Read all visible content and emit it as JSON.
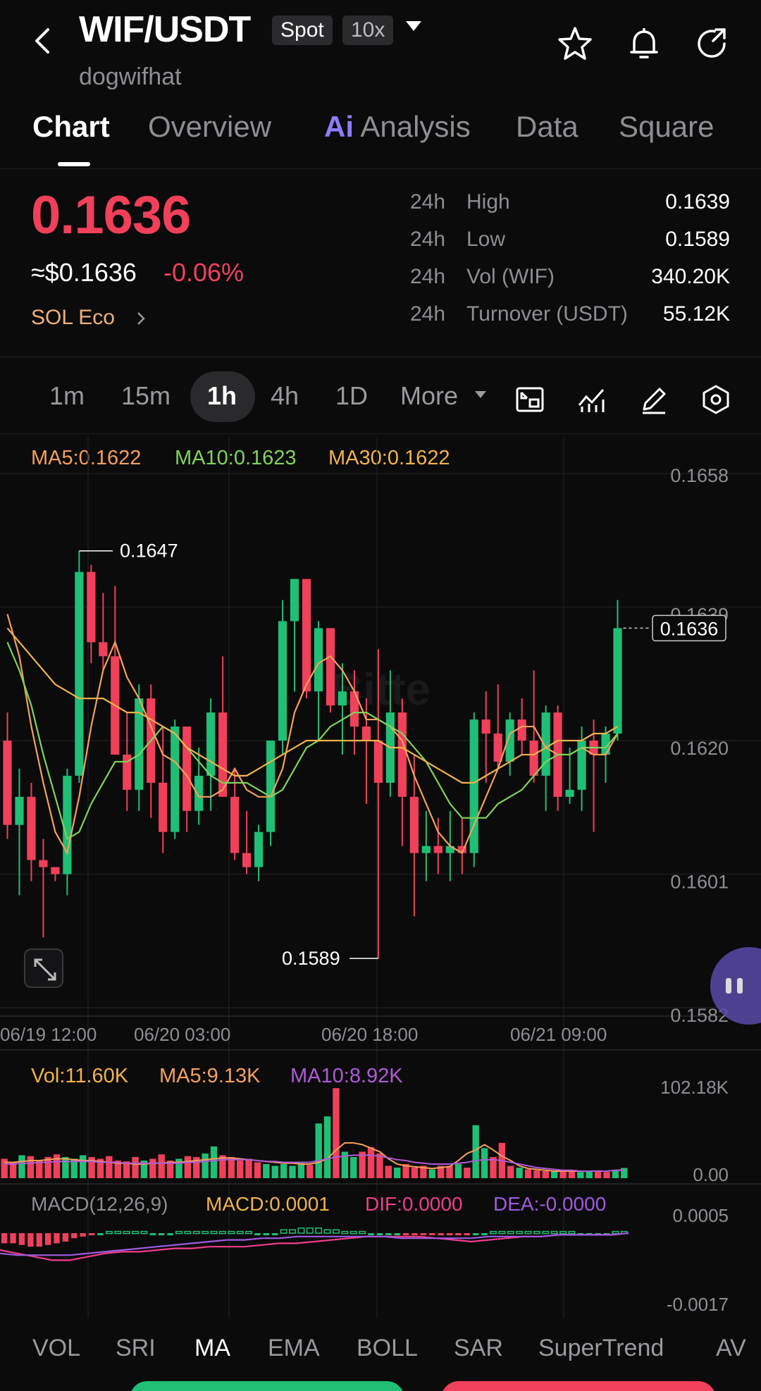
{
  "header": {
    "pair": "WIF/USDT",
    "spot_tag": "Spot",
    "leverage_tag": "10x",
    "subname": "dogwifhat"
  },
  "tabs": [
    {
      "label": "Chart"
    },
    {
      "label": "Overview"
    },
    {
      "label": "Analysis",
      "badge": "Ai"
    },
    {
      "label": "Data"
    },
    {
      "label": "Square"
    }
  ],
  "price": {
    "last": "0.1636",
    "usd": "≈$0.1636",
    "change": "-0.06%",
    "eco": "SOL Eco"
  },
  "stats": [
    {
      "period": "24h",
      "label": "High",
      "value": "0.1639"
    },
    {
      "period": "24h",
      "label": "Low",
      "value": "0.1589"
    },
    {
      "period": "24h",
      "label": "Vol (WIF)",
      "value": "340.20K"
    },
    {
      "period": "24h",
      "label": "Turnover (USDT)",
      "value": "55.12K"
    }
  ],
  "intervals": [
    "1m",
    "15m",
    "1h",
    "4h",
    "1D",
    "More"
  ],
  "chart": {
    "ma_legend": {
      "ma5": "MA5:0.1622",
      "ma10": "MA10:0.1623",
      "ma30": "MA30:0.1622"
    },
    "price_axis": [
      "0.1658",
      "0.1639",
      "0.1620",
      "0.1601",
      "0.1582"
    ],
    "current_price_tag": "0.1636",
    "high_label": "0.1647",
    "low_label": "0.1589",
    "time_axis": [
      "06/19 12:00",
      "06/20 03:00",
      "06/20 18:00",
      "06/21 09:00"
    ],
    "volume_legend": {
      "vol": "Vol:11.60K",
      "ma5": "MA5:9.13K",
      "ma10": "MA10:8.92K"
    },
    "volume_axis": [
      "102.18K",
      "0.00"
    ],
    "macd_legend": {
      "name": "MACD(12,26,9)",
      "macd": "MACD:0.0001",
      "dif": "DIF:0.0000",
      "dea": "DEA:-0.0000"
    },
    "macd_axis": [
      "0.0005",
      "-0.0017"
    ],
    "colors": {
      "up": "#1fbf75",
      "down": "#f0405a",
      "ma5": "#f5a05a",
      "ma10": "#7fd45a",
      "ma30": "#f2b24a",
      "vol_ma10": "#b05ad8",
      "dif": "#f03c8c",
      "dea": "#a05ae0"
    }
  },
  "indicator_tabs": [
    "VOL",
    "SRI",
    "MA",
    "EMA",
    "BOLL",
    "SAR",
    "SuperTrend",
    "AV"
  ],
  "chart_data": {
    "type": "candlestick",
    "interval": "1h",
    "ylim": [
      0.1582,
      0.1658
    ],
    "x_ticks": [
      "06/19 12:00",
      "06/20 03:00",
      "06/20 18:00",
      "06/21 09:00"
    ],
    "candles": [
      [
        0.162,
        0.1624,
        0.1606,
        0.1608
      ],
      [
        0.1608,
        0.1616,
        0.1598,
        0.1612
      ],
      [
        0.1612,
        0.1614,
        0.16,
        0.1603
      ],
      [
        0.1603,
        0.1606,
        0.1592,
        0.1602
      ],
      [
        0.1602,
        0.1602,
        0.16,
        0.1601
      ],
      [
        0.1601,
        0.1616,
        0.1598,
        0.1615
      ],
      [
        0.1615,
        0.1647,
        0.1614,
        0.1644
      ],
      [
        0.1644,
        0.1645,
        0.1631,
        0.1634
      ],
      [
        0.1634,
        0.1641,
        0.163,
        0.1632
      ],
      [
        0.1632,
        0.1642,
        0.1618,
        0.1618
      ],
      [
        0.1618,
        0.1624,
        0.161,
        0.1613
      ],
      [
        0.1613,
        0.1628,
        0.161,
        0.1626
      ],
      [
        0.1626,
        0.1628,
        0.1609,
        0.1614
      ],
      [
        0.1614,
        0.1622,
        0.1604,
        0.1607
      ],
      [
        0.1607,
        0.1623,
        0.1606,
        0.1622
      ],
      [
        0.1622,
        0.1622,
        0.1607,
        0.161
      ],
      [
        0.161,
        0.1619,
        0.1608,
        0.1615
      ],
      [
        0.1615,
        0.1626,
        0.161,
        0.1624
      ],
      [
        0.1624,
        0.1632,
        0.1612,
        0.1612
      ],
      [
        0.1612,
        0.1616,
        0.1603,
        0.1604
      ],
      [
        0.1604,
        0.161,
        0.1601,
        0.1602
      ],
      [
        0.1602,
        0.1608,
        0.16,
        0.1607
      ],
      [
        0.1607,
        0.162,
        0.1605,
        0.162
      ],
      [
        0.162,
        0.164,
        0.1618,
        0.1637
      ],
      [
        0.1637,
        0.1642,
        0.1627,
        0.1643
      ],
      [
        0.1643,
        0.1643,
        0.1626,
        0.1627
      ],
      [
        0.1627,
        0.1637,
        0.162,
        0.1636
      ],
      [
        0.1636,
        0.1636,
        0.1624,
        0.1625
      ],
      [
        0.1625,
        0.1631,
        0.1618,
        0.1627
      ],
      [
        0.1627,
        0.163,
        0.1618,
        0.1622
      ],
      [
        0.1622,
        0.1626,
        0.1611,
        0.162
      ],
      [
        0.162,
        0.1633,
        0.1589,
        0.1614
      ],
      [
        0.1614,
        0.163,
        0.1612,
        0.1624
      ],
      [
        0.1624,
        0.1626,
        0.1605,
        0.1612
      ],
      [
        0.1612,
        0.1618,
        0.1595,
        0.1604
      ],
      [
        0.1604,
        0.161,
        0.16,
        0.1605
      ],
      [
        0.1605,
        0.1609,
        0.1601,
        0.1604
      ],
      [
        0.1604,
        0.161,
        0.16,
        0.1605
      ],
      [
        0.1605,
        0.1609,
        0.1601,
        0.1604
      ],
      [
        0.1604,
        0.1624,
        0.1602,
        0.1623
      ],
      [
        0.1623,
        0.1627,
        0.1614,
        0.1621
      ],
      [
        0.1621,
        0.1628,
        0.1616,
        0.1617
      ],
      [
        0.1617,
        0.1624,
        0.1615,
        0.1623
      ],
      [
        0.1623,
        0.1626,
        0.1618,
        0.162
      ],
      [
        0.162,
        0.163,
        0.1614,
        0.1615
      ],
      [
        0.1615,
        0.1625,
        0.161,
        0.1624
      ],
      [
        0.1624,
        0.1625,
        0.161,
        0.1612
      ],
      [
        0.1612,
        0.1619,
        0.1611,
        0.1613
      ],
      [
        0.1613,
        0.1622,
        0.161,
        0.162
      ],
      [
        0.162,
        0.1623,
        0.1607,
        0.1618
      ],
      [
        0.1618,
        0.1622,
        0.1614,
        0.1621
      ],
      [
        0.1621,
        0.164,
        0.162,
        0.1636
      ]
    ],
    "series": [
      {
        "name": "MA5",
        "values": [
          0.1638,
          0.1632,
          0.1622,
          0.1614,
          0.1607,
          0.1604,
          0.1612,
          0.1622,
          0.163,
          0.1634,
          0.1629,
          0.1626,
          0.1622,
          0.1618,
          0.1617,
          0.1615,
          0.1612,
          0.1612,
          0.1613,
          0.1616,
          0.1613,
          0.1612,
          0.1612,
          0.1616,
          0.1624,
          0.1628,
          0.1631,
          0.1632,
          0.163,
          0.1627,
          0.1623,
          0.1623,
          0.1622,
          0.162,
          0.1615,
          0.1611,
          0.1607,
          0.1605,
          0.1604,
          0.1608,
          0.1612,
          0.1616,
          0.1621,
          0.1622,
          0.1622,
          0.1619,
          0.1618,
          0.1618,
          0.1619,
          0.1618,
          0.1618,
          0.1621
        ]
      },
      {
        "name": "MA10",
        "values": [
          0.1634,
          0.163,
          0.1625,
          0.1618,
          0.1612,
          0.1606,
          0.1607,
          0.1611,
          0.1614,
          0.1617,
          0.1617,
          0.1618,
          0.162,
          0.1622,
          0.1621,
          0.1619,
          0.1617,
          0.1615,
          0.1614,
          0.1614,
          0.1614,
          0.1613,
          0.1612,
          0.1613,
          0.1616,
          0.1619,
          0.162,
          0.1622,
          0.1623,
          0.1624,
          0.1624,
          0.1623,
          0.1622,
          0.1621,
          0.1619,
          0.1617,
          0.1614,
          0.1611,
          0.1609,
          0.1609,
          0.1609,
          0.1611,
          0.1612,
          0.1613,
          0.1615,
          0.1617,
          0.1618,
          0.1618,
          0.1619,
          0.1619,
          0.1619,
          0.1621
        ]
      },
      {
        "name": "MA30",
        "values": [
          0.1636,
          0.1634,
          0.1632,
          0.163,
          0.1628,
          0.1627,
          0.1626,
          0.1626,
          0.1626,
          0.1625,
          0.1624,
          0.1624,
          0.1623,
          0.1622,
          0.1621,
          0.1619,
          0.1618,
          0.1617,
          0.1616,
          0.1615,
          0.1615,
          0.1616,
          0.1617,
          0.1618,
          0.1619,
          0.162,
          0.162,
          0.162,
          0.162,
          0.162,
          0.162,
          0.162,
          0.1619,
          0.1619,
          0.1618,
          0.1617,
          0.1616,
          0.1615,
          0.1614,
          0.1614,
          0.1615,
          0.1616,
          0.1617,
          0.1618,
          0.1618,
          0.1619,
          0.162,
          0.162,
          0.162,
          0.1621,
          0.1621,
          0.1622
        ]
      }
    ],
    "volume_ylim": [
      0,
      102.18
    ],
    "volume_unit": "K",
    "volume": [
      22,
      18,
      26,
      25,
      20,
      24,
      27,
      24,
      22,
      26,
      24,
      22,
      25,
      20,
      19,
      24,
      20,
      22,
      27,
      20,
      22,
      25,
      24,
      28,
      36,
      26,
      24,
      20,
      22,
      18,
      16,
      14,
      16,
      14,
      17,
      15,
      62,
      70,
      102,
      30,
      24,
      30,
      35,
      28,
      14,
      12,
      16,
      12,
      14,
      10,
      14,
      14,
      16,
      12,
      60,
      34,
      24,
      40,
      14,
      12,
      10,
      9,
      8,
      8,
      9,
      8,
      7,
      8,
      9,
      7,
      9,
      11.6
    ],
    "volume_ma5": [
      18,
      18,
      19,
      20,
      20,
      21,
      22,
      22,
      21,
      20,
      20,
      19,
      18,
      17,
      17,
      16,
      16,
      17,
      17,
      18,
      18,
      19,
      20,
      21,
      22,
      23,
      23,
      22,
      21,
      20,
      19,
      18,
      17,
      17,
      16,
      16,
      18,
      22,
      32,
      40,
      40,
      38,
      34,
      30,
      22,
      16,
      14,
      13,
      12,
      11,
      12,
      13,
      20,
      28,
      32,
      38,
      32,
      25,
      20,
      14,
      11,
      10,
      9,
      8,
      8,
      8,
      8,
      8,
      8,
      8,
      9,
      9.13
    ],
    "volume_ma10": [
      16,
      16,
      17,
      17,
      18,
      18,
      19,
      19,
      19,
      19,
      19,
      18,
      18,
      18,
      17,
      17,
      17,
      17,
      17,
      17,
      17,
      18,
      18,
      19,
      20,
      21,
      21,
      21,
      21,
      20,
      19,
      19,
      18,
      18,
      18,
      18,
      20,
      22,
      24,
      25,
      26,
      26,
      26,
      25,
      23,
      21,
      20,
      18,
      17,
      16,
      16,
      16,
      17,
      18,
      20,
      21,
      21,
      20,
      18,
      16,
      14,
      12,
      11,
      10,
      9,
      9,
      8,
      8,
      8,
      8,
      9,
      8.92
    ],
    "macd_ylim": [
      -0.0017,
      0.0005
    ],
    "macd_hist": [
      -0.0006,
      -0.0006,
      -0.0007,
      -0.0008,
      -0.0008,
      -0.0007,
      -0.0006,
      -0.0005,
      -0.0003,
      -0.0002,
      -0.0001,
      0.0,
      0.0001,
      0.0001,
      0.0001,
      0.0001,
      0.0001,
      0.0,
      0.0,
      0.0,
      0.0001,
      0.0001,
      0.0001,
      0.0001,
      0.0001,
      0.0001,
      0.0001,
      0.0001,
      0.0001,
      0.0,
      0.0,
      0.0,
      0.0002,
      0.0002,
      0.0003,
      0.0003,
      0.0003,
      0.0002,
      0.0002,
      0.0001,
      0.0001,
      0.0001,
      0.0,
      0.0,
      0.0,
      0.0,
      -0.0001,
      -0.0001,
      -0.0001,
      -0.0001,
      -0.0001,
      -0.0001,
      -0.0001,
      -0.0001,
      0.0,
      0.0,
      0.0001,
      0.0001,
      0.0001,
      0.0001,
      0.0001,
      0.0001,
      0.0001,
      0.0001,
      0.0001,
      0.0001,
      0.0,
      0.0,
      0.0,
      0.0,
      0.0001,
      0.0001
    ],
    "dif": [
      -0.001,
      -0.0012,
      -0.0014,
      -0.0016,
      -0.0016,
      -0.0014,
      -0.0012,
      -0.0011,
      -0.0011,
      -0.001,
      -0.0009,
      -0.0009,
      -0.0008,
      -0.0008,
      -0.0008,
      -0.0007,
      -0.0006,
      -0.0006,
      -0.0005,
      -0.0004,
      -0.0003,
      -0.0002,
      -0.0002,
      -0.0002,
      -0.0002,
      -0.0003,
      -0.0004,
      -0.0005,
      -0.0004,
      -0.0003,
      -0.0002,
      -0.0002,
      -0.0001,
      -0.0001,
      -0.0001,
      -0.0001,
      0.0
    ],
    "dea": [
      -0.0012,
      -0.0013,
      -0.0013,
      -0.0013,
      -0.0013,
      -0.0012,
      -0.0011,
      -0.001,
      -0.0009,
      -0.0008,
      -0.0007,
      -0.0006,
      -0.0005,
      -0.0004,
      -0.0004,
      -0.0003,
      -0.0003,
      -0.0002,
      -0.0002,
      -0.0002,
      -0.0002,
      -0.0002,
      -0.0002,
      -0.0003,
      -0.0003,
      -0.0003,
      -0.0003,
      -0.0003,
      -0.0002,
      -0.0002,
      -0.0002,
      -0.0002,
      -0.0001,
      -0.0001,
      -0.0001,
      -0.0001,
      0.0
    ]
  }
}
